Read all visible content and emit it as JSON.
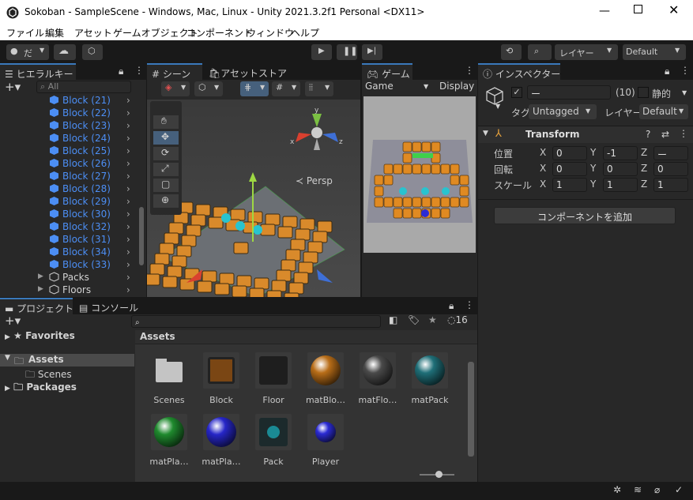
{
  "window": {
    "title": "Sokoban - SampleScene - Windows, Mac, Linux - Unity 2021.3.2f1 Personal <DX11>"
  },
  "menu": [
    "ファイル",
    "編集",
    "アセット",
    "ゲームオブジェクト",
    "コンポーネント",
    "ウィンドウ",
    "ヘルプ"
  ],
  "toolbar": {
    "account": "だ",
    "layers": "レイヤー",
    "layout": "Default"
  },
  "hierarchy": {
    "tab": "ヒエラルキー",
    "search_placeholder": "All",
    "blocks": [
      "Block (21)",
      "Block (22)",
      "Block (23)",
      "Block (24)",
      "Block (25)",
      "Block (26)",
      "Block (27)",
      "Block (28)",
      "Block (29)",
      "Block (30)",
      "Block (32)",
      "Block (31)",
      "Block (34)",
      "Block (33)"
    ],
    "groups": [
      "Packs",
      "Floors"
    ]
  },
  "scene": {
    "tab": "シーン",
    "persp": "Persp",
    "gizmo": {
      "y": "y",
      "x": "x",
      "z": "z"
    }
  },
  "assetstore": {
    "tab": "アセットストア"
  },
  "game": {
    "tab": "ゲーム",
    "mode": "Game",
    "display": "Display"
  },
  "inspector": {
    "tab": "インスペクター",
    "name": "ー",
    "layer_count": "(10)",
    "static": "静的",
    "tag_label": "タグ",
    "tag": "Untagged",
    "layer_label": "レイヤー",
    "layer": "Default",
    "transform": {
      "title": "Transform",
      "rows": [
        {
          "label": "位置",
          "x": "0",
          "y": "-1",
          "z": "ー"
        },
        {
          "label": "回転",
          "x": "0",
          "y": "0",
          "z": "0"
        },
        {
          "label": "スケール",
          "x": "1",
          "y": "1",
          "z": "1"
        }
      ]
    },
    "add_component": "コンポーネントを追加"
  },
  "project": {
    "tab": "プロジェクト",
    "console_tab": "コンソール",
    "hidden_count": "16",
    "tree": {
      "favorites": "Favorites",
      "assets": "Assets",
      "scenes": "Scenes",
      "packages": "Packages"
    },
    "breadcrumb": "Assets",
    "assets": [
      {
        "name": "Scenes",
        "kind": "folder"
      },
      {
        "name": "Block",
        "kind": "block"
      },
      {
        "name": "Floor",
        "kind": "floor"
      },
      {
        "name": "matBlo…",
        "kind": "mat",
        "color": "#b86d18"
      },
      {
        "name": "matFlo…",
        "kind": "mat",
        "color": "#4a4a4a"
      },
      {
        "name": "matPack",
        "kind": "mat",
        "color": "#1f6f78"
      },
      {
        "name": "matPla…",
        "kind": "mat",
        "color": "#1f8a2e"
      },
      {
        "name": "matPla…",
        "kind": "mat",
        "color": "#2626c8"
      },
      {
        "name": "Pack",
        "kind": "pack"
      },
      {
        "name": "Player",
        "kind": "player",
        "color": "#2b2bd4"
      }
    ]
  }
}
